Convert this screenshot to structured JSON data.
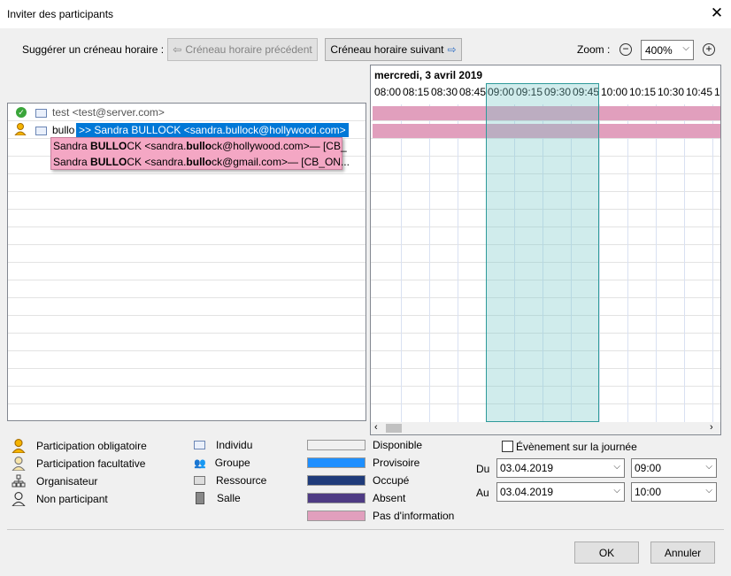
{
  "window": {
    "title": "Inviter des participants"
  },
  "toolbar": {
    "suggest_label": "Suggérer un créneau horaire :",
    "prev_label": "Créneau horaire précédent",
    "next_label": "Créneau horaire suivant",
    "zoom_label": "Zoom :",
    "zoom_value": "400%"
  },
  "participants": {
    "rows": [
      {
        "text": "test <test@server.com>"
      },
      {
        "text": "bullo"
      }
    ],
    "autocomplete_selected": ">> Sandra BULLOCK <sandra.bullock@hollywood.com>",
    "suggestions": [
      {
        "pre": "Sandra ",
        "bold": "BULLO",
        "mid": "CK <sandra.",
        "bold2": "bullo",
        "post": "ck@hollywood.com>— [CB_"
      },
      {
        "pre": "Sandra ",
        "bold": "BULLO",
        "mid": "CK <sandra.",
        "bold2": "bullo",
        "post": "ck@gmail.com>— [CB_ON..."
      }
    ]
  },
  "schedule": {
    "date": "mercredi, 3 avril 2019",
    "times": [
      "08:00",
      "08:15",
      "08:30",
      "08:45",
      "09:00",
      "09:15",
      "09:30",
      "09:45",
      "10:00",
      "10:15",
      "10:30",
      "10:45",
      "1"
    ]
  },
  "legend": {
    "roles": [
      "Participation obligatoire",
      "Participation facultative",
      "Organisateur",
      "Non participant"
    ],
    "types": [
      "Individu",
      "Groupe",
      "Ressource",
      "Salle"
    ],
    "status": [
      {
        "label": "Disponible",
        "color": "#f0f0f0"
      },
      {
        "label": "Provisoire",
        "color": "#1e8fff"
      },
      {
        "label": "Occupé",
        "color": "#1f3b7a"
      },
      {
        "label": "Absent",
        "color": "#4e3b84"
      },
      {
        "label": "Pas d'information",
        "color": "#e19fbd"
      }
    ]
  },
  "event": {
    "allday_label": "Évènement sur la journée",
    "from_label": "Du",
    "to_label": "Au",
    "from_date": "03.04.2019",
    "from_time": "09:00",
    "to_date": "03.04.2019",
    "to_time": "10:00"
  },
  "footer": {
    "ok_label": "OK",
    "cancel_label": "Annuler"
  }
}
